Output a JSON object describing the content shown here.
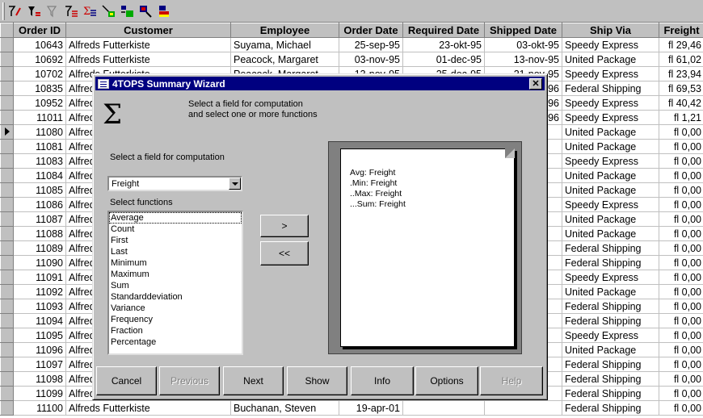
{
  "grid": {
    "columns": [
      "Order ID",
      "Customer",
      "Employee",
      "Order Date",
      "Required Date",
      "Shipped Date",
      "Ship Via",
      "Freight"
    ],
    "rows": [
      [
        "10643",
        "Alfreds Futterkiste",
        "Suyama, Michael",
        "25-sep-95",
        "23-okt-95",
        "03-okt-95",
        "Speedy Express",
        "fl 29,46"
      ],
      [
        "10692",
        "Alfreds Futterkiste",
        "Peacock, Margaret",
        "03-nov-95",
        "01-dec-95",
        "13-nov-95",
        "United Package",
        "fl 61,02"
      ],
      [
        "10702",
        "Alfreds Futterkiste",
        "Peacock, Margaret",
        "13-nov-95",
        "25-dec-95",
        "21-nov-95",
        "Speedy Express",
        "fl 23,94"
      ],
      [
        "10835",
        "Alfreds Futterkiste",
        "",
        "",
        "",
        "96",
        "Federal Shipping",
        "fl 69,53"
      ],
      [
        "10952",
        "Alfreds Futterkiste",
        "",
        "",
        "",
        "96",
        "Speedy Express",
        "fl 40,42"
      ],
      [
        "11011",
        "Alfreds Futterkiste",
        "",
        "",
        "",
        "96",
        "Speedy Express",
        "fl 1,21"
      ],
      [
        "11080",
        "Alfreds Futterkiste",
        "",
        "",
        "",
        "",
        "United Package",
        "fl 0,00"
      ],
      [
        "11081",
        "Alfreds Futterkiste",
        "",
        "",
        "",
        "",
        "United Package",
        "fl 0,00"
      ],
      [
        "11083",
        "Alfreds Futterkiste",
        "",
        "",
        "",
        "",
        "Speedy Express",
        "fl 0,00"
      ],
      [
        "11084",
        "Alfreds Futterkiste",
        "",
        "",
        "",
        "",
        "United Package",
        "fl 0,00"
      ],
      [
        "11085",
        "Alfreds Futterkiste",
        "",
        "",
        "",
        "",
        "United Package",
        "fl 0,00"
      ],
      [
        "11086",
        "Alfreds Futterkiste",
        "",
        "",
        "",
        "",
        "Speedy Express",
        "fl 0,00"
      ],
      [
        "11087",
        "Alfreds Futterkiste",
        "",
        "",
        "",
        "",
        "United Package",
        "fl 0,00"
      ],
      [
        "11088",
        "Alfreds Futterkiste",
        "",
        "",
        "",
        "",
        "United Package",
        "fl 0,00"
      ],
      [
        "11089",
        "Alfreds Futterkiste",
        "",
        "",
        "",
        "",
        "Federal Shipping",
        "fl 0,00"
      ],
      [
        "11090",
        "Alfreds Futterkiste",
        "",
        "",
        "",
        "",
        "Federal Shipping",
        "fl 0,00"
      ],
      [
        "11091",
        "Alfreds Futterkiste",
        "",
        "",
        "",
        "",
        "Speedy Express",
        "fl 0,00"
      ],
      [
        "11092",
        "Alfreds Futterkiste",
        "",
        "",
        "",
        "",
        "United Package",
        "fl 0,00"
      ],
      [
        "11093",
        "Alfreds Futterkiste",
        "",
        "",
        "",
        "",
        "Federal Shipping",
        "fl 0,00"
      ],
      [
        "11094",
        "Alfreds Futterkiste",
        "",
        "",
        "",
        "",
        "Federal Shipping",
        "fl 0,00"
      ],
      [
        "11095",
        "Alfreds Futterkiste",
        "",
        "",
        "",
        "",
        "Speedy Express",
        "fl 0,00"
      ],
      [
        "11096",
        "Alfreds Futterkiste",
        "",
        "",
        "",
        "",
        "United Package",
        "fl 0,00"
      ],
      [
        "11097",
        "Alfreds Futterkiste",
        "",
        "",
        "",
        "",
        "Federal Shipping",
        "fl 0,00"
      ],
      [
        "11098",
        "Alfreds Futterkiste",
        "",
        "",
        "",
        "",
        "Federal Shipping",
        "fl 0,00"
      ],
      [
        "11099",
        "Alfreds Futterkiste",
        "",
        "",
        "",
        "",
        "Federal Shipping",
        "fl 0,00"
      ],
      [
        "11100",
        "Alfreds Futterkiste",
        "Buchanan, Steven",
        "19-apr-01",
        "",
        "",
        "Federal Shipping",
        "fl 0,00"
      ]
    ]
  },
  "toolbar": {
    "icons": [
      "sort-ascending-icon",
      "filter-icon",
      "remove-filter-icon",
      "sort-descending-icon",
      "summary-icon",
      "chart-icon",
      "level-icon",
      "find-icon",
      "print-icon"
    ]
  },
  "dialog": {
    "title": "4TOPS Summary Wizard",
    "close_label": "✕",
    "intro": "Select a field for computation and select one or more functions",
    "field_label": "Select a field for computation",
    "field_value": "Freight",
    "functions_label": "Select functions",
    "functions": [
      "Average",
      "Count",
      "First",
      "Last",
      "Minimum",
      "Maximum",
      "Sum",
      "Standarddeviation",
      "Variance",
      "Frequency",
      "Fraction",
      "Percentage"
    ],
    "add_button": ">",
    "remove_button": "<<",
    "preview_lines": [
      "Avg: Freight",
      ".Min: Freight",
      "..Max: Freight",
      "...Sum: Freight"
    ],
    "buttons": {
      "cancel": "Cancel",
      "previous": "Previous",
      "next": "Next",
      "show": "Show",
      "info": "Info",
      "options": "Options",
      "help": "Help"
    }
  }
}
